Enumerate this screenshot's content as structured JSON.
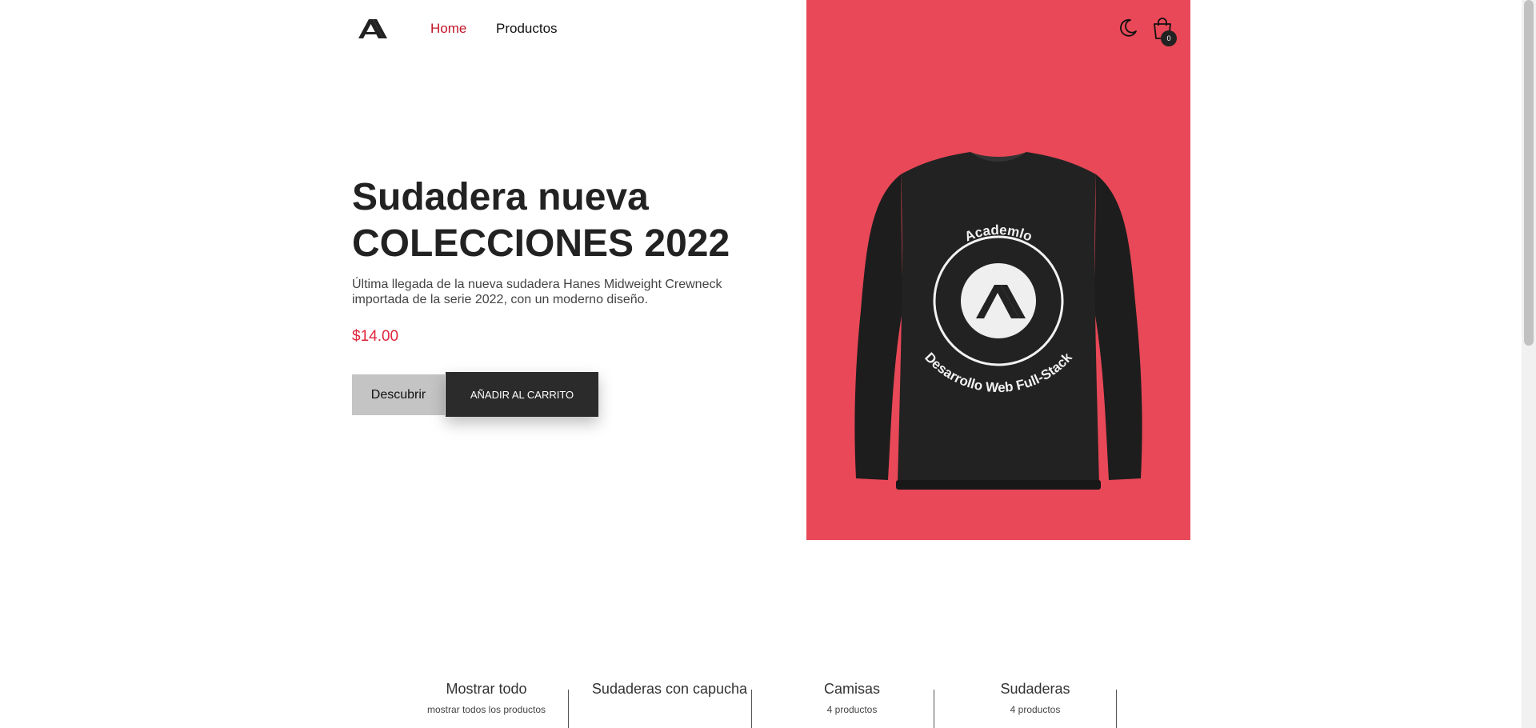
{
  "header": {
    "nav": {
      "home": "Home",
      "products": "Productos"
    },
    "cart_count": "0",
    "active_color": "#c0152a"
  },
  "hero": {
    "title_line1": "Sudadera nueva",
    "title_line2": "COLECCIONES 2022",
    "description": "Última llegada de la nueva sudadera Hanes Midweight Crewneck importada de la serie 2022, con un moderno diseño.",
    "price": "$14.00",
    "discover_label": "Descubrir",
    "add_to_cart_label": "AÑADIR AL CARRITO",
    "panel_color": "#e84857",
    "image": {
      "badge_top_text": "Academlo",
      "badge_bottom_text": "Desarrollo Web Full-Stack"
    }
  },
  "categories": [
    {
      "title": "Mostrar todo",
      "subtitle": "mostrar todos los productos"
    },
    {
      "title": "Sudaderas con capucha",
      "subtitle": ""
    },
    {
      "title": "Camisas",
      "subtitle": "4 productos"
    },
    {
      "title": "Sudaderas",
      "subtitle": "4 productos"
    }
  ],
  "icons": {
    "logo": "logo-icon",
    "theme_toggle": "moon-icon",
    "cart": "shopping-bag-icon"
  }
}
